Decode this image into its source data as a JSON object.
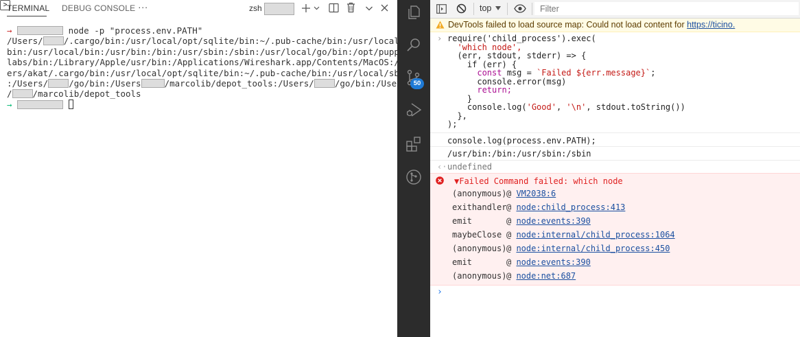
{
  "terminal": {
    "tabs": {
      "terminal": "TERMINAL",
      "debug_console": "DEBUG CONSOLE",
      "more": "···"
    },
    "shell_label": "zsh",
    "prompt_arrow": "→",
    "command": "node -p \"process.env.PATH\"",
    "output_lines": [
      {
        "before": "/Users/",
        "after": "/.cargo/bin:/usr/local/opt/sqlite/bin:~/.pub-cache/bin:/usr/local/s"
      },
      {
        "text": "bin:/usr/local/bin:/usr/bin:/bin:/usr/sbin:/sbin:/usr/local/go/bin:/opt/puppet"
      },
      {
        "text": "labs/bin:/Library/Apple/usr/bin:/Applications/Wireshark.app/Contents/MacOS:/Us"
      },
      {
        "text": "ers/akat/.cargo/bin:/usr/local/opt/sqlite/bin:~/.pub-cache/bin:/usr/local/sbin"
      },
      {
        "a": ":/Users/",
        "b": "/go/bin:/Users",
        "c": "/marcolib/depot_tools:/Users/",
        "d": "/go/bin:/Users"
      },
      {
        "a": "/",
        "b": "/marcolib/depot_tools"
      }
    ]
  },
  "activity_bar": {
    "icons": [
      "explorer-icon",
      "search-icon",
      "source-control-icon",
      "run-debug-icon",
      "extensions-icon",
      "git-graph-icon"
    ],
    "scm_badge": "50",
    "badge_color": "#1e7ad6"
  },
  "devtools": {
    "toolbar": {
      "context": "top",
      "filter_placeholder": "Filter"
    },
    "warning": {
      "text": "DevTools failed to load source map: Could not load content for ",
      "link": "https://ticino."
    },
    "code": {
      "line1": "require('child_process').exec(",
      "line2": "'which node',",
      "line3": "(err, stdout, stderr) => {",
      "line4": "if (err) {",
      "line5_kw": "const",
      "line5_rest": " msg = ",
      "line5_tpl": "`Failed ${err.message}`",
      "line5_end": ";",
      "line6": "console.error(msg)",
      "line7": "return;",
      "line8": "}",
      "line9_a": "console.log(",
      "line9_s1": "'Good'",
      "line9_b": ", ",
      "line9_s2": "'\\n'",
      "line9_c": ", stdout.toString())",
      "line10": "},",
      "line11": ");"
    },
    "log_input": "console.log(process.env.PATH);",
    "log_output": "/usr/bin:/bin:/usr/sbin:/sbin",
    "return_value": "undefined",
    "error": {
      "header": "▼Failed Command failed: which node",
      "color": "#e02020",
      "trace": [
        {
          "fn": "(anonymous)",
          "loc": "VM2038:6"
        },
        {
          "fn": "exithandler",
          "loc": "node:child_process:413"
        },
        {
          "fn": "emit",
          "loc": "node:events:390"
        },
        {
          "fn": "maybeClose",
          "loc": "node:internal/child_process:1064"
        },
        {
          "fn": "(anonymous)",
          "loc": "node:internal/child_process:450"
        },
        {
          "fn": "emit",
          "loc": "node:events:390"
        },
        {
          "fn": "(anonymous)",
          "loc": "node:net:687"
        }
      ]
    }
  }
}
